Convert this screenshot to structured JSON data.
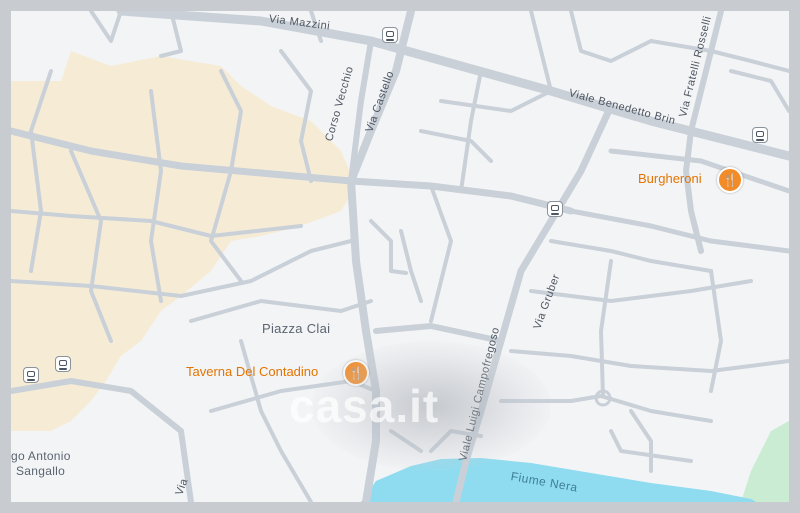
{
  "map": {
    "streets": [
      {
        "id": "via-mazzini",
        "label": "Via Mazzini"
      },
      {
        "id": "corso-vecchio",
        "label": "Corso Vecchio"
      },
      {
        "id": "via-castello",
        "label": "Via Castello"
      },
      {
        "id": "viale-benedetto-brin",
        "label": "Viale Benedetto Brin"
      },
      {
        "id": "via-fratelli-rosselli",
        "label": "Via Fratelli Rosselli"
      },
      {
        "id": "via-gruber",
        "label": "Via Gruber"
      },
      {
        "id": "viale-luigi-campofregoso",
        "label": "Viale Luigi Campofregoso"
      },
      {
        "id": "via-bottom",
        "label": "Via"
      }
    ],
    "squares": [
      {
        "label": "Piazza Clai"
      },
      {
        "label": "Largo Antonio Sangallo",
        "line1": "go Antonio",
        "line2": "Sangallo"
      }
    ],
    "river": {
      "label": "Fiume Nera",
      "color": "#8fdcf0"
    },
    "pois": [
      {
        "name": "Burgheroni",
        "icon": "restaurant-icon"
      },
      {
        "name": "Taverna Del Contadino",
        "icon": "restaurant-icon"
      }
    ],
    "transit_icon": "bus-stop-icon",
    "watermark": "casa.it",
    "colors": {
      "background": "#f3f4f6",
      "roads": "#c9d0d8",
      "pedestrian_zone": "#f6ecd6",
      "river": "#8fdcf0",
      "park": "#c9ecd2",
      "poi": "#e37400"
    }
  }
}
